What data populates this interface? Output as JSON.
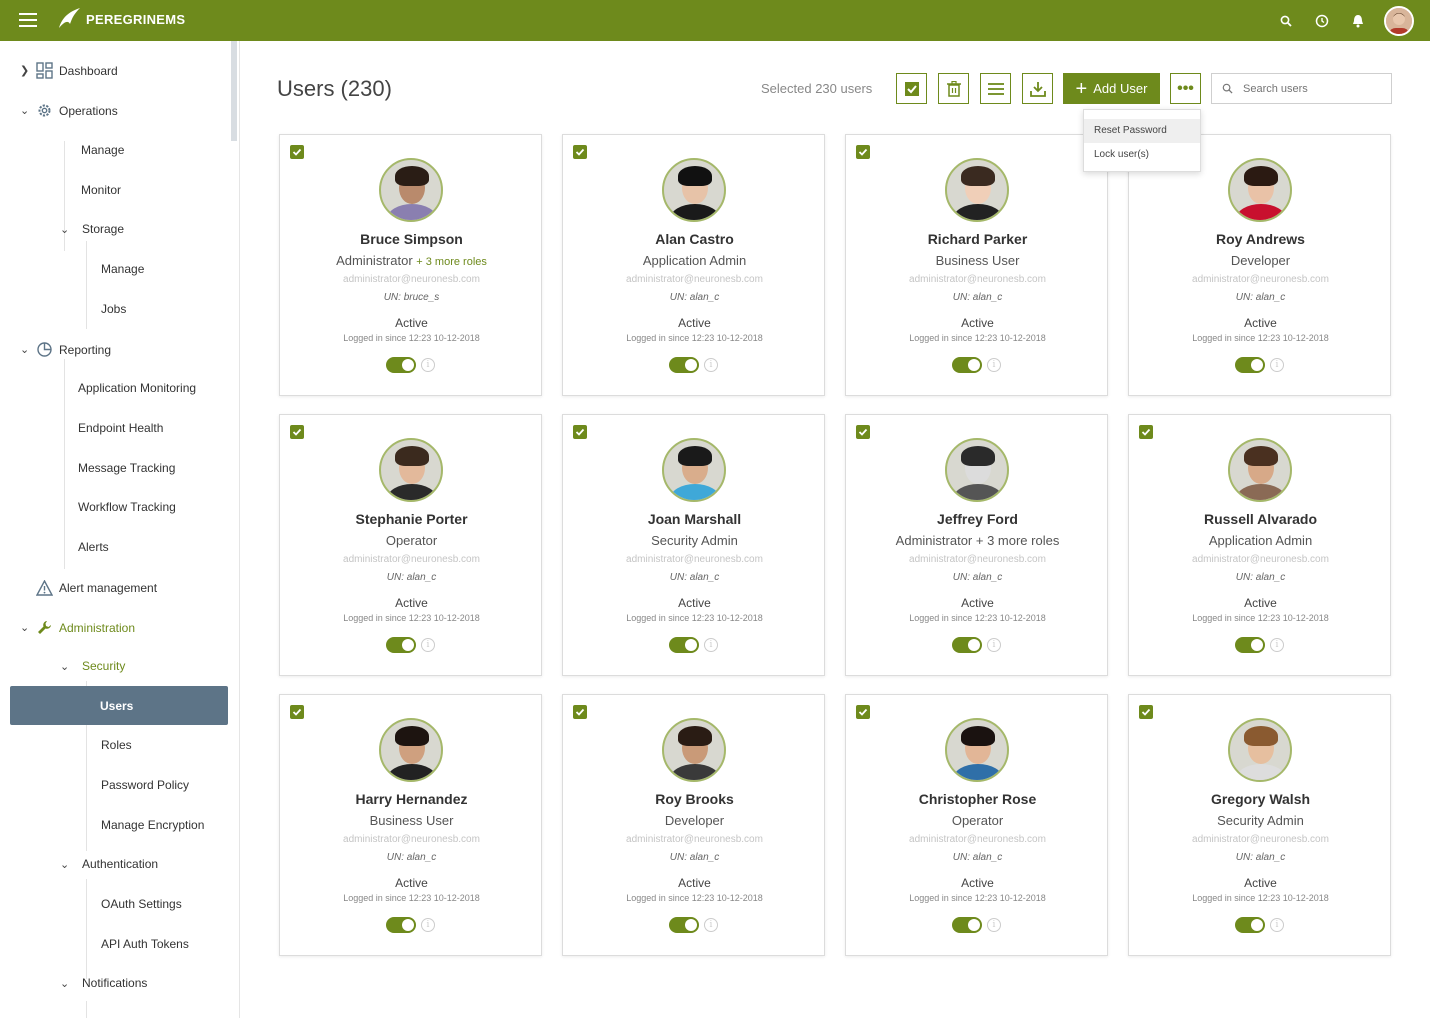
{
  "app": {
    "name": "PEREGRINEMS",
    "brand_color": "#6e8a1c"
  },
  "topbar_icons": [
    "search-icon",
    "history-icon",
    "bell-icon",
    "user-avatar"
  ],
  "sidebar": {
    "dashboard": "Dashboard",
    "operations": "Operations",
    "ops_manage": "Manage",
    "ops_monitor": "Monitor",
    "storage": "Storage",
    "storage_manage": "Manage",
    "storage_jobs": "Jobs",
    "reporting": "Reporting",
    "app_monitoring": "Application Monitoring",
    "endpoint_health": "Endpoint Health",
    "message_tracking": "Message Tracking",
    "workflow_tracking": "Workflow Tracking",
    "alerts": "Alerts",
    "alert_management": "Alert management",
    "administration": "Administration",
    "security": "Security",
    "users": "Users",
    "roles": "Roles",
    "password_policy": "Password Policy",
    "manage_encryption": "Manage Encryption",
    "authentication": "Authentication",
    "oauth_settings": "OAuth Settings",
    "api_auth_tokens": "API Auth Tokens",
    "notifications": "Notifications"
  },
  "main": {
    "title": "Users (230)",
    "selected_text": "Selected 230 users",
    "add_user_label": "Add User",
    "search_placeholder": "Search users",
    "dropdown": [
      "Reset Password",
      "Lock user(s)"
    ]
  },
  "users": [
    {
      "name": "Bruce Simpson",
      "role": "Administrator",
      "more_roles": "+ 3 more roles",
      "email": "administrator@neuronesb.com",
      "un": "UN: bruce_s",
      "status": "Active",
      "logged": "Logged in since 12:23 10-12-2018",
      "enabled": true,
      "skin": "#b98a6c",
      "hair": "#2a1d15",
      "shirt": "#8a7fb0"
    },
    {
      "name": "Alan Castro",
      "role": "Application Admin",
      "more_roles": "",
      "email": "administrator@neuronesb.com",
      "un": "UN: alan_c",
      "status": "Active",
      "logged": "Logged in since 12:23 10-12-2018",
      "enabled": true,
      "skin": "#e7c3a8",
      "hair": "#111111",
      "shirt": "#1a1a1a"
    },
    {
      "name": "Richard Parker",
      "role": "Business User",
      "more_roles": "",
      "email": "administrator@neuronesb.com",
      "un": "UN: alan_c",
      "status": "Active",
      "logged": "Logged in since 12:23 10-12-2018",
      "enabled": true,
      "skin": "#f0cfb8",
      "hair": "#3a2a20",
      "shirt": "#222222"
    },
    {
      "name": "Roy Andrews",
      "role": "Developer",
      "more_roles": "",
      "email": "administrator@neuronesb.com",
      "un": "UN: alan_c",
      "status": "Active",
      "logged": "Logged in since 12:23 10-12-2018",
      "enabled": true,
      "skin": "#e9c2a7",
      "hair": "#2b1a12",
      "shirt": "#c8102e"
    },
    {
      "name": "Stephanie Porter",
      "role": "Operator",
      "more_roles": "",
      "email": "administrator@neuronesb.com",
      "un": "UN: alan_c",
      "status": "Active",
      "logged": "Logged in since 12:23 10-12-2018",
      "enabled": true,
      "skin": "#e3b99b",
      "hair": "#3b2a1e",
      "shirt": "#2a2a2a"
    },
    {
      "name": "Joan Marshall",
      "role": "Security Admin",
      "more_roles": "",
      "email": "administrator@neuronesb.com",
      "un": "UN: alan_c",
      "status": "Active",
      "logged": "Logged in since 12:23 10-12-2018",
      "enabled": true,
      "skin": "#d9ad8c",
      "hair": "#1a1a1a",
      "shirt": "#3fa8d8"
    },
    {
      "name": "Jeffrey Ford",
      "role": "Administrator + 3 more roles",
      "more_roles": "",
      "email": "administrator@neuronesb.com",
      "un": "UN: alan_c",
      "status": "Active",
      "logged": "Logged in since 12:23 10-12-2018",
      "enabled": true,
      "skin": "#dcdcdc",
      "hair": "#2a2a2a",
      "shirt": "#555555"
    },
    {
      "name": "Russell Alvarado",
      "role": "Application Admin",
      "more_roles": "",
      "email": "administrator@neuronesb.com",
      "un": "UN: alan_c",
      "status": "Active",
      "logged": "Logged in since 12:23 10-12-2018",
      "enabled": true,
      "skin": "#d7a988",
      "hair": "#4a3020",
      "shirt": "#8a6a55"
    },
    {
      "name": "Harry Hernandez",
      "role": "Business User",
      "more_roles": "",
      "email": "administrator@neuronesb.com",
      "un": "UN: alan_c",
      "status": "Active",
      "logged": "Logged in since 12:23 10-12-2018",
      "enabled": true,
      "skin": "#cfa07f",
      "hair": "#1d1410",
      "shirt": "#222222"
    },
    {
      "name": "Roy Brooks",
      "role": "Developer",
      "more_roles": "",
      "email": "administrator@neuronesb.com",
      "un": "UN: alan_c",
      "status": "Active",
      "logged": "Logged in since 12:23 10-12-2018",
      "enabled": true,
      "skin": "#c99a78",
      "hair": "#2a1c14",
      "shirt": "#3a3a3a"
    },
    {
      "name": "Christopher Rose",
      "role": "Operator",
      "more_roles": "",
      "email": "administrator@neuronesb.com",
      "un": "UN: alan_c",
      "status": "Active",
      "logged": "Logged in since 12:23 10-12-2018",
      "enabled": true,
      "skin": "#e2b697",
      "hair": "#1a1210",
      "shirt": "#2f6fa8"
    },
    {
      "name": "Gregory Walsh",
      "role": "Security Admin",
      "more_roles": "",
      "email": "administrator@neuronesb.com",
      "un": "UN: alan_c",
      "status": "Active",
      "logged": "Logged in since 12:23 10-12-2018",
      "enabled": true,
      "skin": "#e6bf9f",
      "hair": "#8a5a30",
      "shirt": "#dddddd"
    }
  ]
}
